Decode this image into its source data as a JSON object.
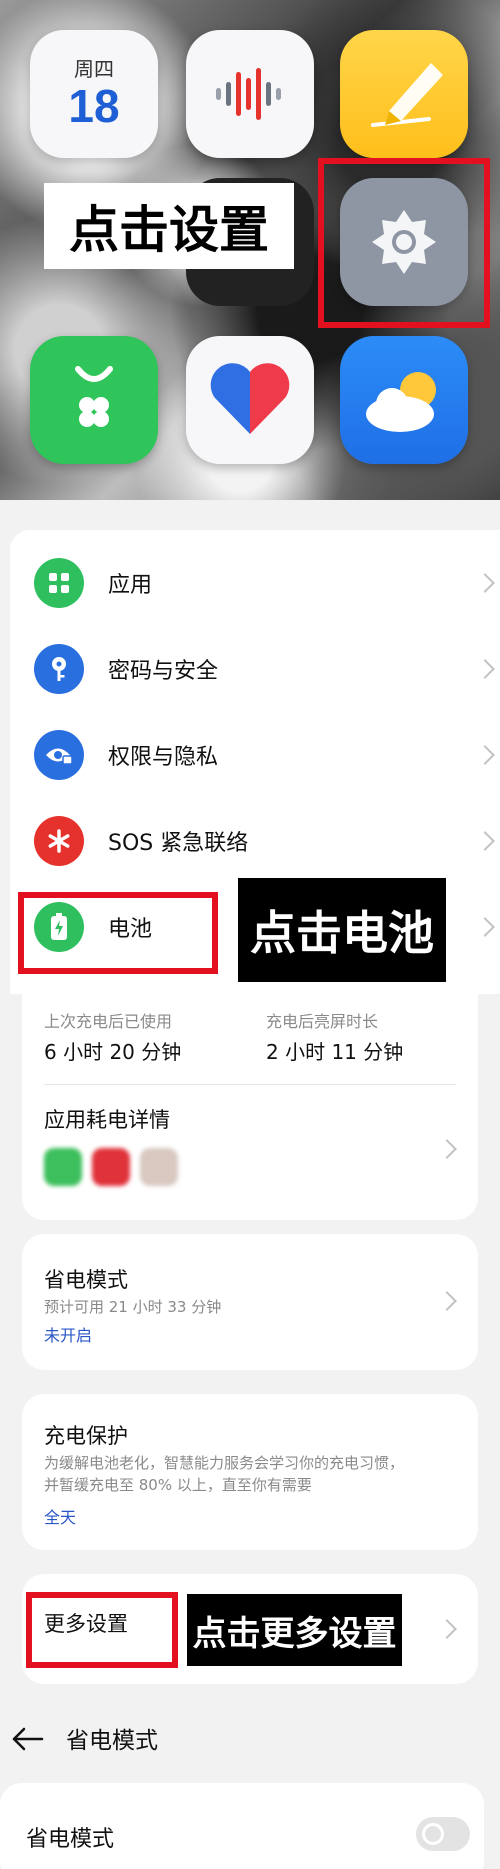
{
  "home_screen": {
    "calendar": {
      "weekday": "周四",
      "day": "18"
    },
    "apps": [
      "calendar-icon",
      "recorder-icon",
      "notes-icon",
      "settings-icon",
      "app-market-icon",
      "health-icon",
      "weather-icon"
    ],
    "callout_settings": "点击设置"
  },
  "settings_list": {
    "items": [
      {
        "label": "应用",
        "icon": "apps-icon",
        "color": "#2fbf5f"
      },
      {
        "label": "密码与安全",
        "icon": "key-icon",
        "color": "#2a6fe0"
      },
      {
        "label": "权限与隐私",
        "icon": "eye-lock-icon",
        "color": "#2a6fe0"
      },
      {
        "label": "SOS 紧急联络",
        "icon": "sos-asterisk-icon",
        "color": "#e5322c"
      },
      {
        "label": "电池",
        "icon": "battery-icon",
        "color": "#2fbf5f"
      }
    ],
    "callout_battery": "点击电池"
  },
  "battery_page": {
    "usage": {
      "since_charge_label": "上次充电后已使用",
      "since_charge_value": "6 小时 20 分钟",
      "screen_on_label": "充电后亮屏时长",
      "screen_on_value": "2 小时 11 分钟"
    },
    "app_usage_title": "应用耗电详情",
    "power_saving": {
      "title": "省电模式",
      "estimate": "预计可用 21 小时 33 分钟",
      "status": "未开启"
    },
    "charge_protection": {
      "title": "充电保护",
      "description_line1": "为缓解电池老化，智慧能力服务会学习你的充电习惯，",
      "description_line2": "并暂缓充电至 80% 以上，直至你有需要",
      "status": "全天"
    },
    "more_settings": "更多设置",
    "callout_more": "点击更多设置"
  },
  "power_saving_page": {
    "title": "省电模式",
    "toggle_label": "省电模式",
    "toggle_on": false
  },
  "colors": {
    "highlight": "#e3101f",
    "link": "#2a56c6",
    "green": "#2fbf5f",
    "blue": "#2a6fe0",
    "red": "#e5322c"
  }
}
